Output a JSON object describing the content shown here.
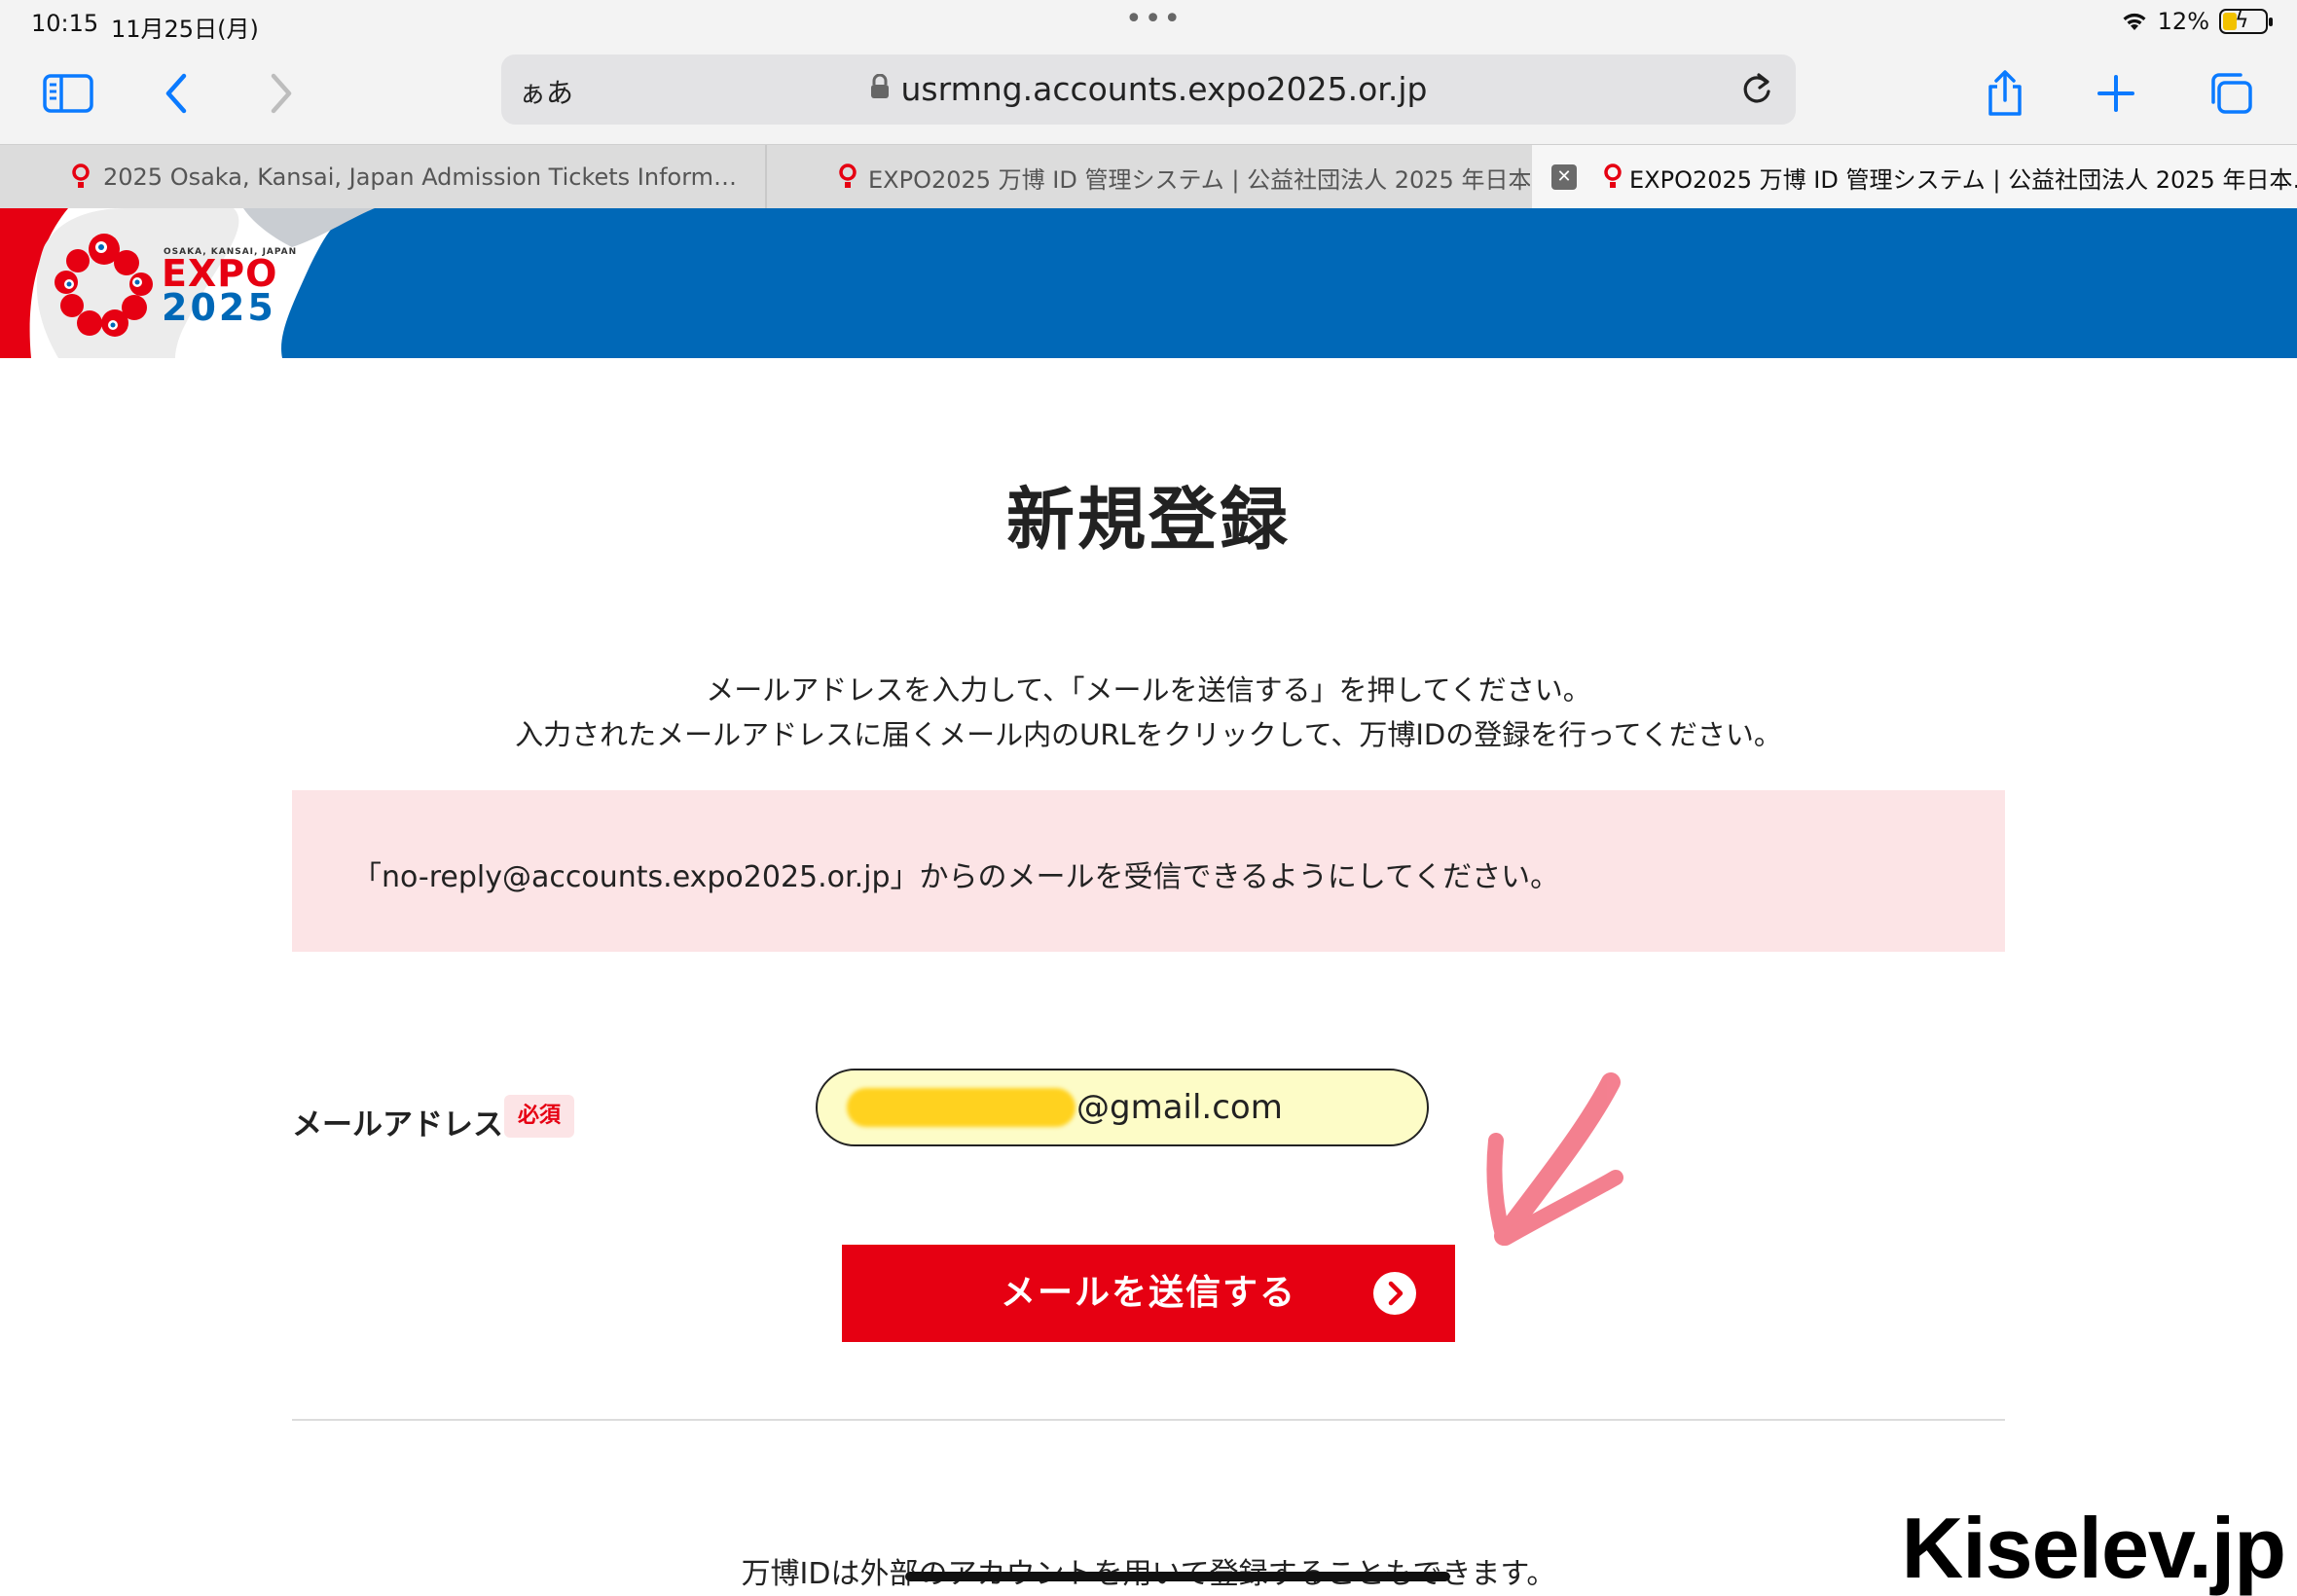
{
  "status_bar": {
    "time": "10:15",
    "date": "11月25日(月)",
    "battery": "12%"
  },
  "browser": {
    "aa_label": "ぁあ",
    "url": "usrmng.accounts.expo2025.or.jp",
    "tabs": [
      {
        "label": "2025 Osaka, Kansai, Japan Admission Tickets Inform…"
      },
      {
        "label": "EXPO2025 万博 ID 管理システム | 公益社団法人 2025 年日本…"
      },
      {
        "label": "EXPO2025 万博 ID 管理システム | 公益社団法人 2025 年日本…",
        "active": true
      }
    ]
  },
  "header": {
    "logo_small": "OSAKA, KANSAI, JAPAN",
    "logo_expo": "EXPO",
    "logo_year": "2025"
  },
  "main": {
    "title": "新規登録",
    "desc_line1": "メールアドレスを入力して、「メールを送信する」を押してください。",
    "desc_line2": "入力されたメールアドレスに届くメール内のURLをクリックして、万博IDの登録を行ってください。",
    "notice": "「no-reply@accounts.expo2025.or.jp」からのメールを受信できるようにしてください。",
    "email_label": "メールアドレス",
    "required": "必須",
    "email_domain": "@gmail.com",
    "send_button": "メールを送信する",
    "bottom_text": "万博IDは外部のアカウントを用いて登録することもできます。"
  },
  "watermark": "Kiselev.jp",
  "colors": {
    "brand_red": "#e60012",
    "brand_blue": "#0068b7",
    "notice_bg": "#fce4e6",
    "input_bg": "#fdfcc7"
  }
}
